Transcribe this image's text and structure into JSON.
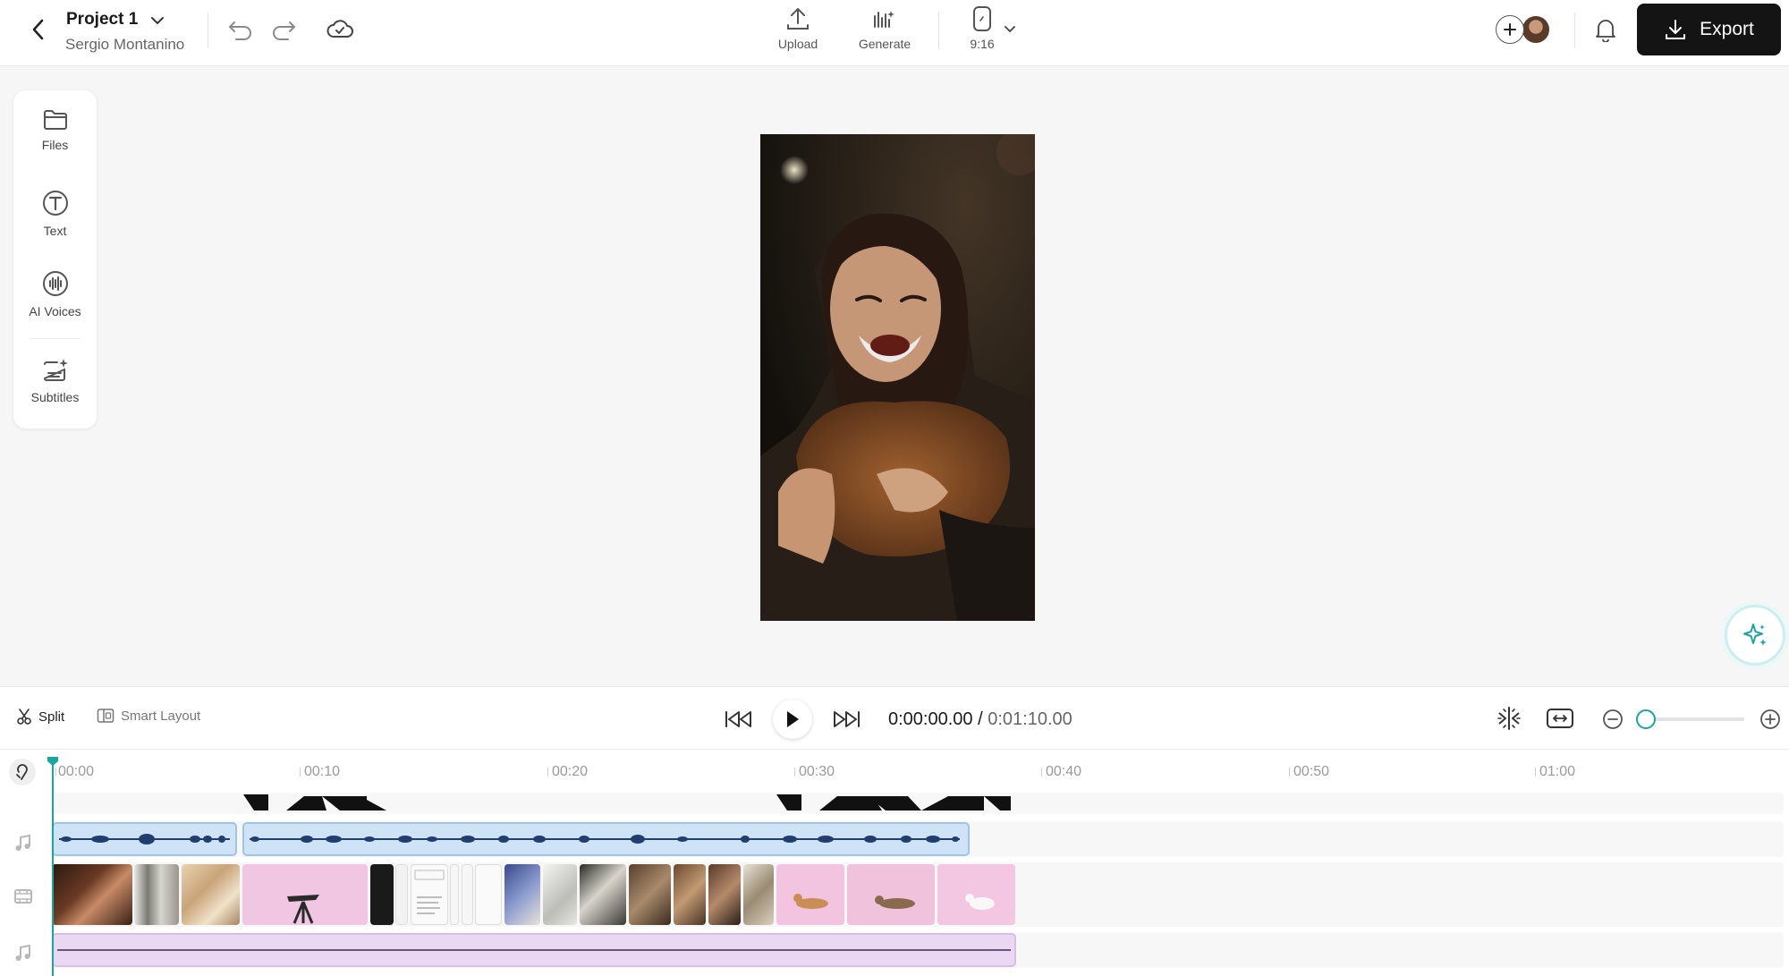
{
  "project": {
    "title": "Project 1",
    "owner": "Sergio Montanino"
  },
  "toolbar": {
    "upload_label": "Upload",
    "generate_label": "Generate",
    "aspect_label": "9:16",
    "export_label": "Export"
  },
  "sidebar": {
    "items": [
      {
        "label": "Files",
        "icon": "folder-icon"
      },
      {
        "label": "Text",
        "icon": "text-icon"
      },
      {
        "label": "AI Voices",
        "icon": "voice-icon"
      },
      {
        "label": "Subtitles",
        "icon": "subtitles-icon"
      }
    ]
  },
  "controls": {
    "split_label": "Split",
    "smart_layout_label": "Smart Layout",
    "current_time": "0:00:00.00",
    "separator": "/",
    "total_time": "0:01:10.00",
    "zoom_level": 0.05
  },
  "timeline": {
    "ruler": [
      "00:00",
      "00:10",
      "00:20",
      "00:30",
      "00:40",
      "00:50",
      "01:00"
    ]
  },
  "colors": {
    "accent": "#1aa6a0",
    "export_bg": "#141414",
    "audio_clip": "#cfe3f6",
    "music_clip": "#ead7f2"
  }
}
